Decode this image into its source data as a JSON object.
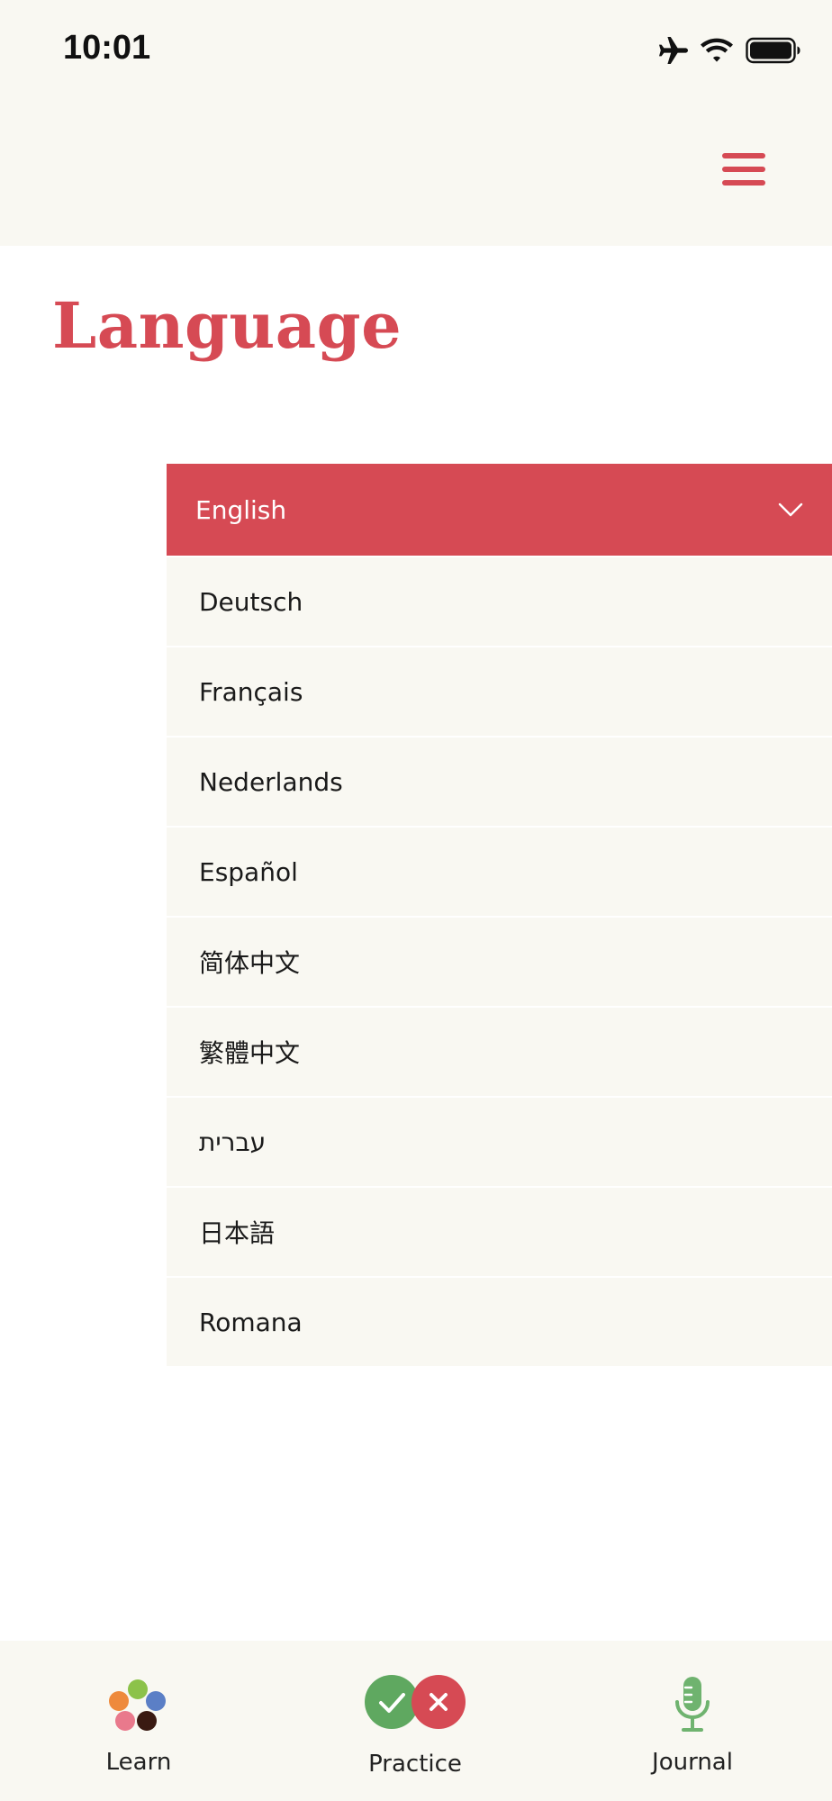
{
  "status_bar": {
    "time": "10:01",
    "icons": [
      "airplane-icon",
      "wifi-icon",
      "battery-icon"
    ]
  },
  "header": {
    "menu_icon": "hamburger-menu-icon"
  },
  "page": {
    "title": "Language"
  },
  "language_picker": {
    "selected": "English",
    "options": [
      "Deutsch",
      "Français",
      "Nederlands",
      "Español",
      "简体中文",
      "繁體中文",
      "עברית",
      "日本語",
      "Romana"
    ]
  },
  "tab_bar": {
    "tabs": [
      {
        "label": "Learn",
        "icon": "learn-dots-icon"
      },
      {
        "label": "Practice",
        "icon": "practice-check-cross-icon"
      },
      {
        "label": "Journal",
        "icon": "microphone-icon"
      }
    ]
  },
  "colors": {
    "accent": "#d64a54",
    "header_bg": "#f9f8f2",
    "list_bg": "#f9f8f2",
    "practice_green": "#5fa860",
    "journal_green": "#6fb36f"
  }
}
